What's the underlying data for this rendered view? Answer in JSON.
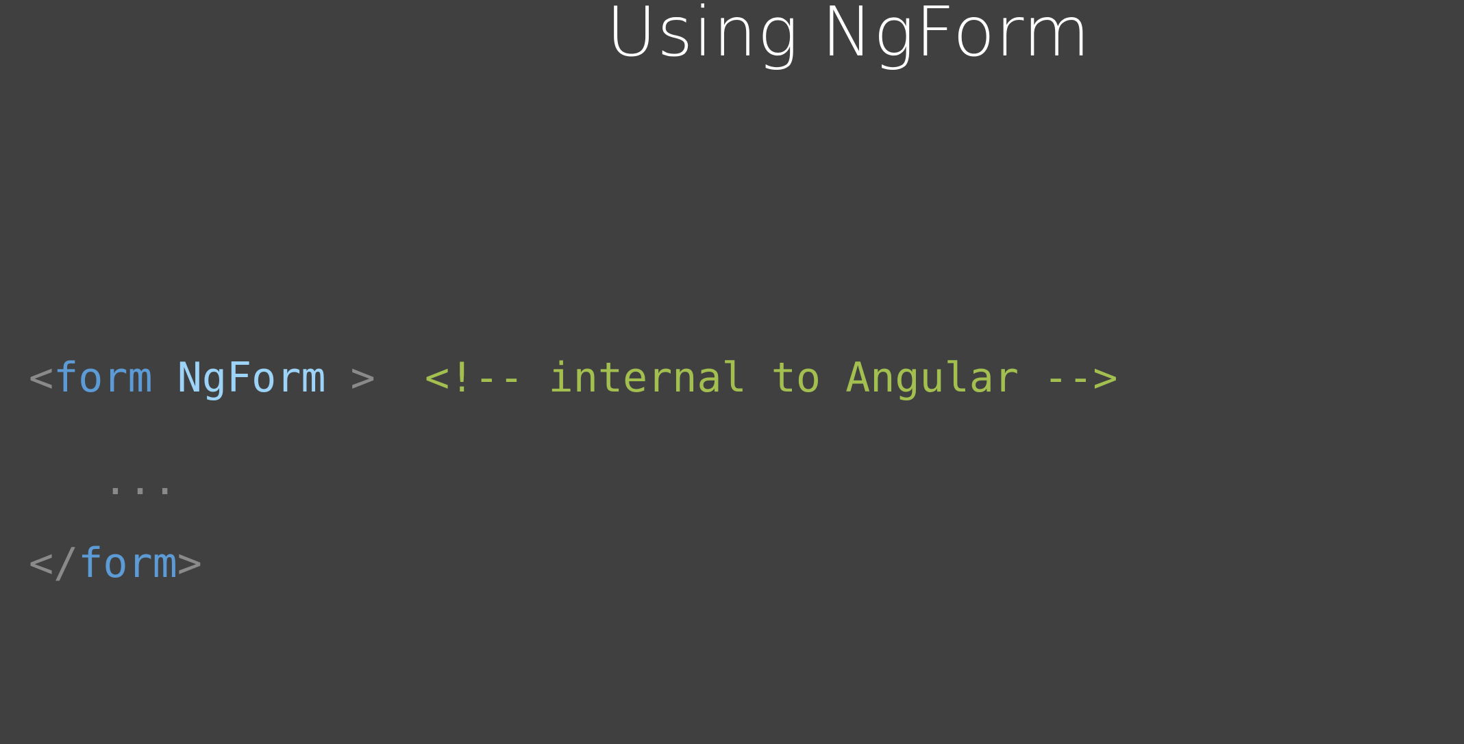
{
  "slide": {
    "title": "Using NgForm",
    "code": {
      "line1": {
        "open_bracket": "<",
        "tag": "form",
        "space": " ",
        "directive": "NgForm",
        "close_bracket": " >",
        "gap": "  ",
        "comment": "<!-- internal to Angular -->"
      },
      "line2": {
        "indent": "   ",
        "ellipsis": "..."
      },
      "line3": {
        "open_bracket": "</",
        "tag": "form",
        "close_bracket": ">"
      }
    },
    "colors": {
      "background": "#404040",
      "title": "#ffffff",
      "punctuation": "#8a8a8a",
      "tag": "#5c9bd6",
      "directive": "#9cd3f7",
      "comment": "#a3bf4f"
    }
  }
}
